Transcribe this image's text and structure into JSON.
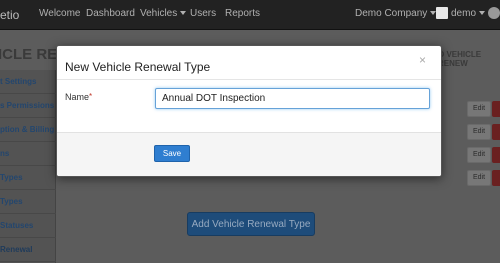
{
  "topbar": {
    "brand": "etio",
    "nav": [
      "Welcome",
      "Dashboard",
      "Vehicles",
      "Users",
      "Reports"
    ],
    "company": "Demo Company",
    "user": "demo"
  },
  "page": {
    "title": "ICLE RENEW",
    "header_right": "O VEHICLE RENEW"
  },
  "sidebar": {
    "items": [
      {
        "label": "t Settings"
      },
      {
        "label": "s Permissions"
      },
      {
        "label": "ption & Billing"
      },
      {
        "label": "ns"
      },
      {
        "label": "Types"
      },
      {
        "label": "Types"
      },
      {
        "label": "Statuses"
      },
      {
        "label": "Renewal Types"
      }
    ]
  },
  "table": {
    "edit_label": "Edit"
  },
  "add_button": "Add Vehicle Renewal Type",
  "modal": {
    "title": "New Vehicle Renewal Type",
    "close": "×",
    "name_label": "Name",
    "required_marker": "*",
    "name_value": "Annual DOT Inspection",
    "save_label": "Save"
  }
}
